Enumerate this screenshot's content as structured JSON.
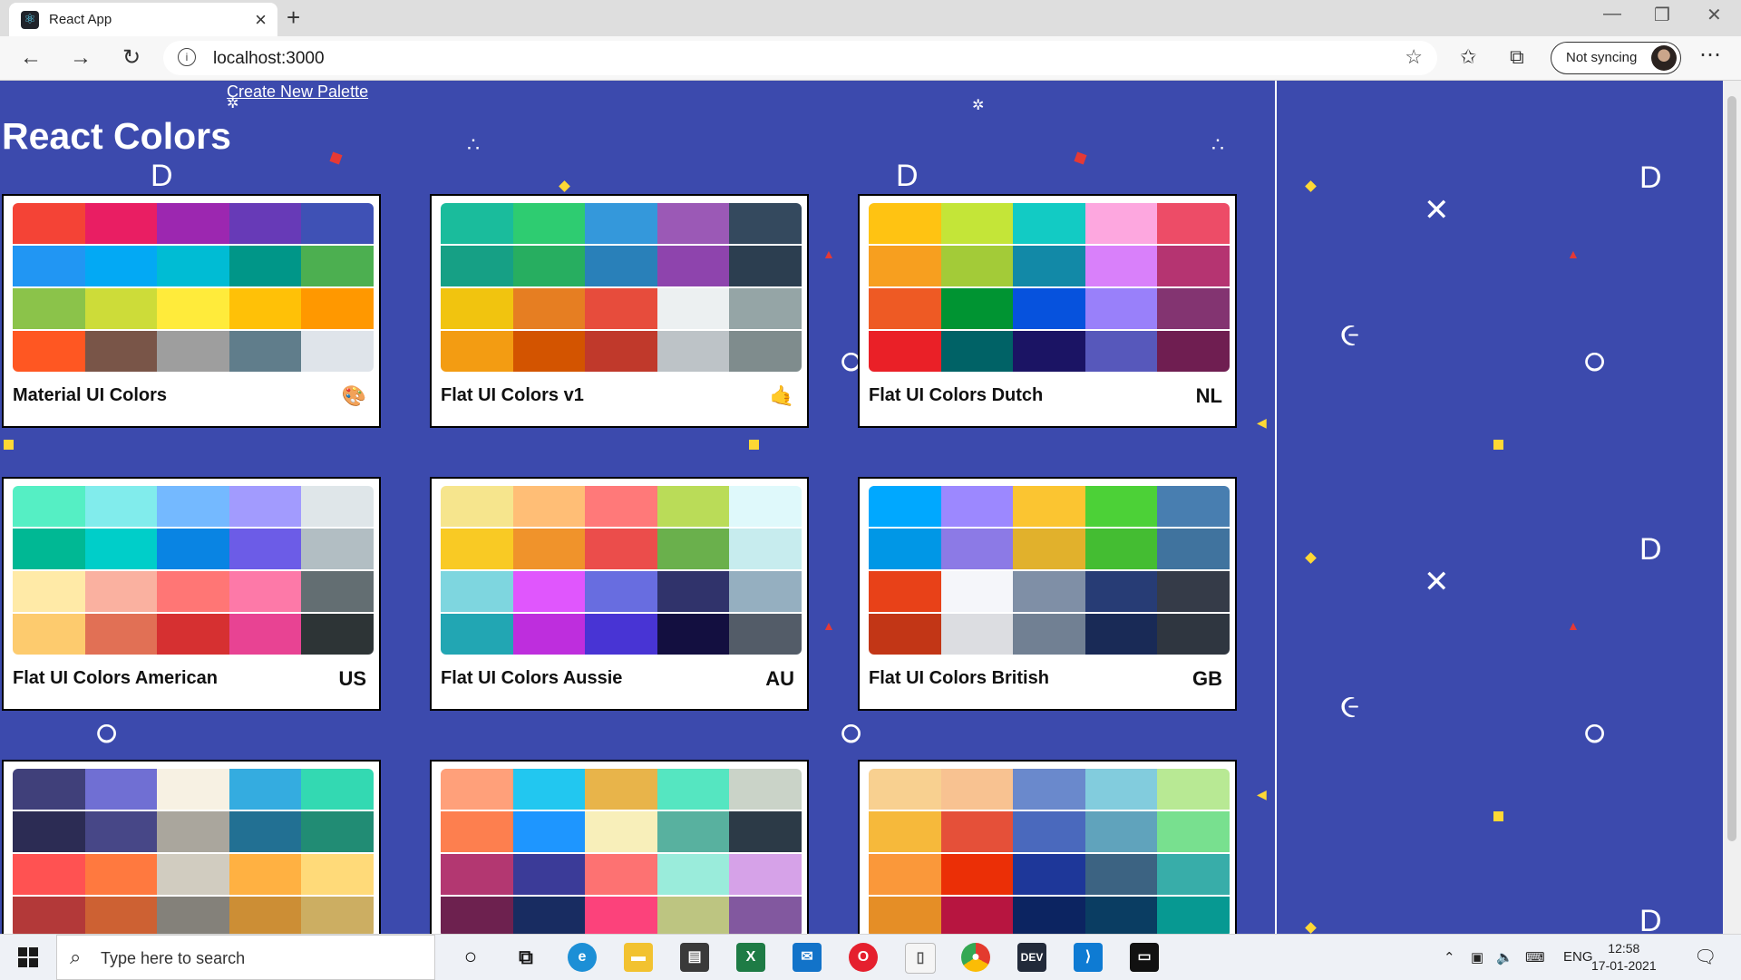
{
  "browser": {
    "tab_title": "React App",
    "new_tab": "+",
    "url": "localhost:3000",
    "sync_label": "Not syncing"
  },
  "page": {
    "create_link": "Create New Palette",
    "title": "React Colors",
    "palettes": [
      {
        "name": "Material UI Colors",
        "emoji": "🎨",
        "colors": [
          "#f44336",
          "#e91e63",
          "#9c27b0",
          "#673ab7",
          "#3f51b5",
          "#2196f3",
          "#03a9f4",
          "#00bcd4",
          "#009688",
          "#4caf50",
          "#8bc34a",
          "#cddc39",
          "#ffeb3b",
          "#ffc107",
          "#ff9800",
          "#ff5722",
          "#795548",
          "#9e9e9e",
          "#607d8b",
          "#dfe4ea"
        ]
      },
      {
        "name": "Flat UI Colors v1",
        "emoji": "🤙",
        "colors": [
          "#1abc9c",
          "#2ecc71",
          "#3498db",
          "#9b59b6",
          "#34495e",
          "#16a085",
          "#27ae60",
          "#2980b9",
          "#8e44ad",
          "#2c3e50",
          "#f1c40f",
          "#e67e22",
          "#e74c3c",
          "#ecf0f1",
          "#95a5a6",
          "#f39c12",
          "#d35400",
          "#c0392b",
          "#bdc3c7",
          "#7f8c8d"
        ]
      },
      {
        "name": "Flat UI Colors Dutch",
        "emoji": "NL",
        "colors": [
          "#ffc312",
          "#c4e538",
          "#12cbc4",
          "#fda7df",
          "#ed4c67",
          "#f79f1f",
          "#a3cb38",
          "#1289a7",
          "#d980fa",
          "#b53471",
          "#ee5a24",
          "#009432",
          "#0652dd",
          "#9980fa",
          "#833471",
          "#ea2027",
          "#006266",
          "#1b1464",
          "#5758bb",
          "#6f1e51"
        ]
      },
      {
        "name": "Flat UI Colors American",
        "emoji": "US",
        "colors": [
          "#55efc4",
          "#81ecec",
          "#74b9ff",
          "#a29bfe",
          "#dfe6e9",
          "#00b894",
          "#00cec9",
          "#0984e3",
          "#6c5ce7",
          "#b2bec3",
          "#ffeaa7",
          "#fab1a0",
          "#ff7675",
          "#fd79a8",
          "#636e72",
          "#fdcb6e",
          "#e17055",
          "#d63031",
          "#e84393",
          "#2d3436"
        ]
      },
      {
        "name": "Flat UI Colors Aussie",
        "emoji": "AU",
        "colors": [
          "#f6e58d",
          "#ffbe76",
          "#ff7979",
          "#badc58",
          "#dff9fb",
          "#f9ca24",
          "#f0932b",
          "#eb4d4b",
          "#6ab04c",
          "#c7ecee",
          "#7ed6df",
          "#e056fd",
          "#686de0",
          "#30336b",
          "#95afc0",
          "#22a6b3",
          "#be2edd",
          "#4834d4",
          "#130f40",
          "#535c68"
        ]
      },
      {
        "name": "Flat UI Colors British",
        "emoji": "GB",
        "colors": [
          "#00a8ff",
          "#9c88ff",
          "#fbc531",
          "#4cd137",
          "#487eb0",
          "#0097e6",
          "#8c7ae6",
          "#e1b12c",
          "#44bd32",
          "#40739e",
          "#e84118",
          "#f5f6fa",
          "#7f8fa6",
          "#273c75",
          "#353b48",
          "#c23616",
          "#dcdde1",
          "#718093",
          "#192a56",
          "#2f3640"
        ]
      },
      {
        "name": "",
        "emoji": "",
        "colors": [
          "#40407a",
          "#706fd3",
          "#f7f1e3",
          "#34ace0",
          "#33d9b2",
          "#2c2c54",
          "#474787",
          "#aaa69d",
          "#227093",
          "#218c74",
          "#ff5252",
          "#ff793f",
          "#d1ccc0",
          "#ffb142",
          "#ffda79",
          "#b33939",
          "#cd6133",
          "#84817a",
          "#cc8e35",
          "#ccae62"
        ]
      },
      {
        "name": "",
        "emoji": "",
        "colors": [
          "#ffa07a",
          "#22c7f0",
          "#e8b44a",
          "#55e6c1",
          "#cad3c8",
          "#fd7f4f",
          "#1e96ff",
          "#f8efba",
          "#58b19f",
          "#2c3a47",
          "#b33771",
          "#3b3b98",
          "#fd7272",
          "#9aecdb",
          "#d6a2e8",
          "#6d214f",
          "#182c61",
          "#fc427b",
          "#bdc581",
          "#82589f"
        ]
      },
      {
        "name": "",
        "emoji": "",
        "colors": [
          "#f8d090",
          "#f8c291",
          "#6a89cc",
          "#82ccdd",
          "#b8e994",
          "#f6b93b",
          "#e55039",
          "#4a69bd",
          "#60a3bc",
          "#78e08f",
          "#fa983a",
          "#eb2f06",
          "#1e3799",
          "#3c6382",
          "#38ada9",
          "#e58e26",
          "#b71540",
          "#0c2461",
          "#0a3d62",
          "#079992"
        ]
      }
    ]
  },
  "taskbar": {
    "search_placeholder": "Type here to search",
    "language": "ENG",
    "time": "12:58",
    "date": "17-01-2021"
  }
}
